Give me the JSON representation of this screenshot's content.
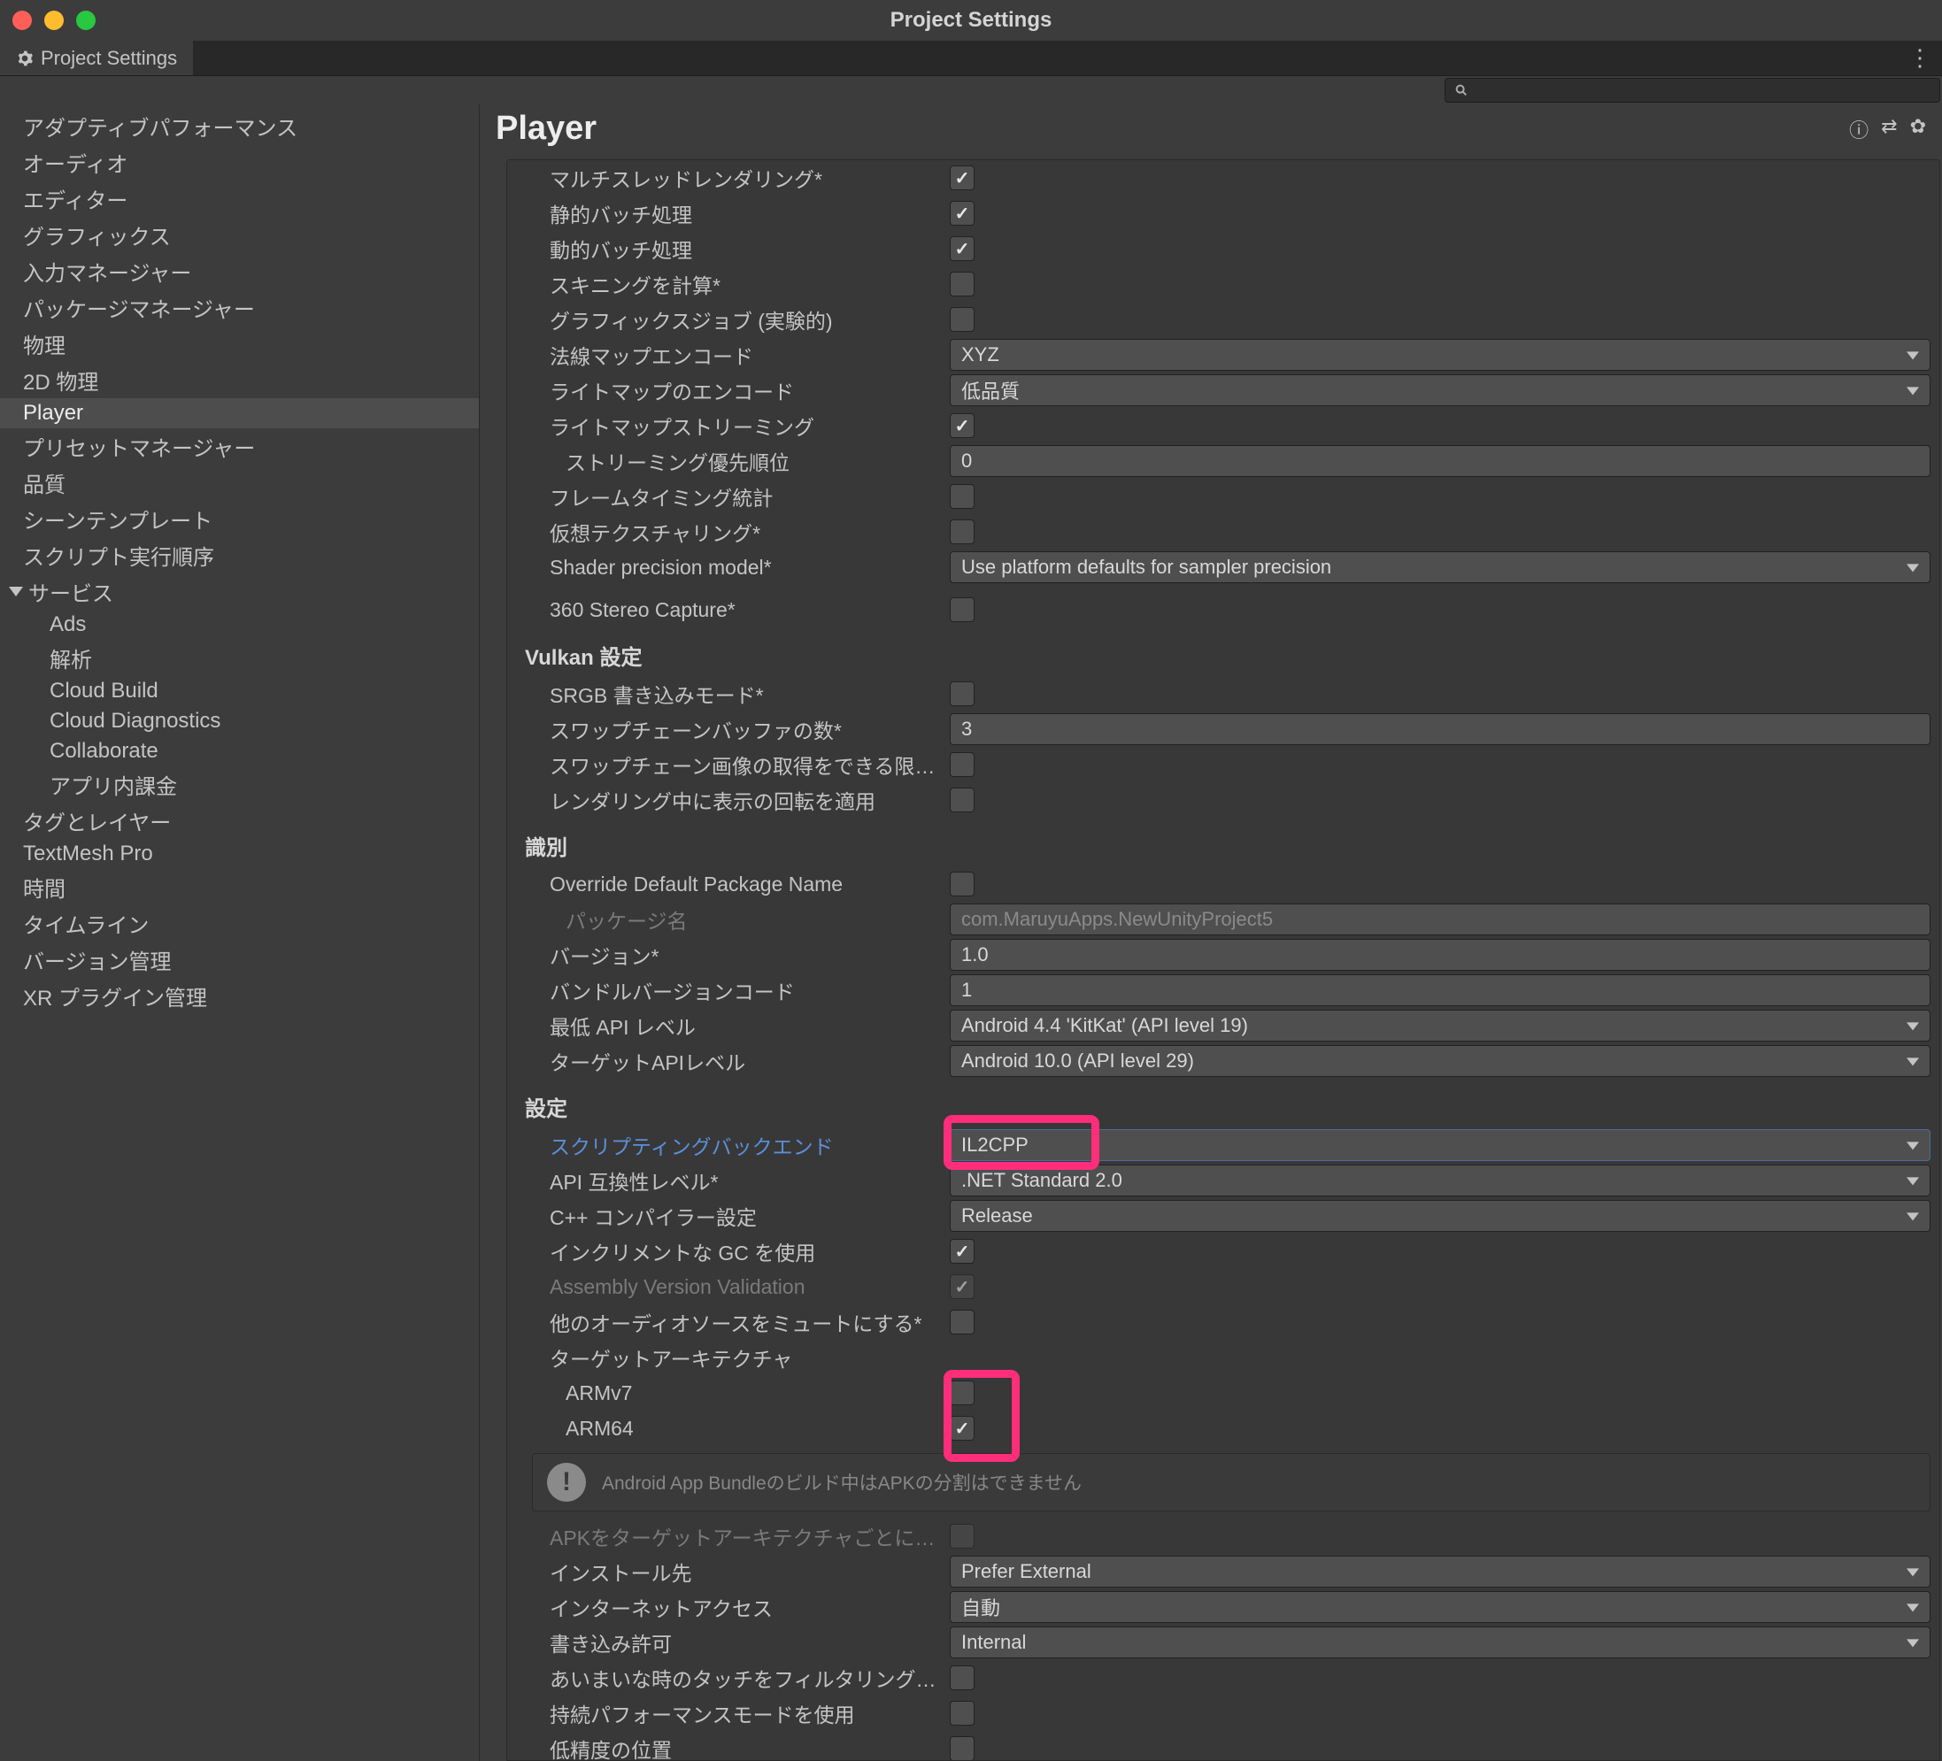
{
  "window": {
    "title": "Project Settings"
  },
  "tab": {
    "label": "Project Settings"
  },
  "sidebar": {
    "items": [
      {
        "label": "アダプティブパフォーマンス"
      },
      {
        "label": "オーディオ"
      },
      {
        "label": "エディター"
      },
      {
        "label": "グラフィックス"
      },
      {
        "label": "入力マネージャー"
      },
      {
        "label": "パッケージマネージャー"
      },
      {
        "label": "物理"
      },
      {
        "label": "2D 物理"
      },
      {
        "label": "Player",
        "selected": true
      },
      {
        "label": "プリセットマネージャー"
      },
      {
        "label": "品質"
      },
      {
        "label": "シーンテンプレート"
      },
      {
        "label": "スクリプト実行順序"
      },
      {
        "label": "サービス",
        "expanded": true,
        "children": [
          {
            "label": "Ads"
          },
          {
            "label": "解析"
          },
          {
            "label": "Cloud Build"
          },
          {
            "label": "Cloud Diagnostics"
          },
          {
            "label": "Collaborate"
          },
          {
            "label": "アプリ内課金"
          }
        ]
      },
      {
        "label": "タグとレイヤー"
      },
      {
        "label": "TextMesh Pro"
      },
      {
        "label": "時間"
      },
      {
        "label": "タイムライン"
      },
      {
        "label": "バージョン管理"
      },
      {
        "label": "XR プラグイン管理"
      }
    ]
  },
  "content": {
    "title": "Player",
    "fields": {
      "multithreadedRendering": {
        "label": "マルチスレッドレンダリング*",
        "checked": true
      },
      "staticBatching": {
        "label": "静的バッチ処理",
        "checked": true
      },
      "dynamicBatching": {
        "label": "動的バッチ処理",
        "checked": true
      },
      "computeSkinning": {
        "label": "スキニングを計算*",
        "checked": false
      },
      "graphicsJobs": {
        "label": "グラフィックスジョブ (実験的)",
        "checked": false
      },
      "normalMapEncoding": {
        "label": "法線マップエンコード",
        "value": "XYZ"
      },
      "lightmapEncoding": {
        "label": "ライトマップのエンコード",
        "value": "低品質"
      },
      "lightmapStreaming": {
        "label": "ライトマップストリーミング",
        "checked": true
      },
      "streamingPriority": {
        "label": "ストリーミング優先順位",
        "value": "0"
      },
      "frameTimingStats": {
        "label": "フレームタイミング統計",
        "checked": false
      },
      "virtualTexturing": {
        "label": "仮想テクスチャリング*",
        "checked": false
      },
      "shaderPrecision": {
        "label": "Shader precision model*",
        "value": "Use platform defaults for sampler precision"
      },
      "stereo360": {
        "label": "360 Stereo Capture*",
        "checked": false
      }
    },
    "vulkan": {
      "title": "Vulkan 設定",
      "srgbWrite": {
        "label": "SRGB 書き込みモード*",
        "checked": false
      },
      "swapchainBuffers": {
        "label": "スワップチェーンバッファの数*",
        "value": "3"
      },
      "swapchainAcquire": {
        "label": "スワップチェーン画像の取得をできる限り遅",
        "checked": false
      },
      "renderingRotation": {
        "label": "レンダリング中に表示の回転を適用",
        "checked": false
      }
    },
    "identification": {
      "title": "識別",
      "overrideDefaultPkg": {
        "label": "Override Default Package Name",
        "checked": false
      },
      "packageName": {
        "label": "パッケージ名",
        "value": "com.MaruyuApps.NewUnityProject5"
      },
      "version": {
        "label": "バージョン*",
        "value": "1.0"
      },
      "bundleVersionCode": {
        "label": "バンドルバージョンコード",
        "value": "1"
      },
      "minApi": {
        "label": "最低 API レベル",
        "value": "Android 4.4 'KitKat' (API level 19)"
      },
      "targetApi": {
        "label": "ターゲットAPIレベル",
        "value": "Android 10.0 (API level 29)"
      }
    },
    "config": {
      "title": "設定",
      "scriptingBackend": {
        "label": "スクリプティングバックエンド",
        "value": "IL2CPP"
      },
      "apiCompat": {
        "label": "API 互換性レベル*",
        "value": ".NET Standard 2.0"
      },
      "cppCompiler": {
        "label": "C++ コンパイラー設定",
        "value": "Release"
      },
      "incrementalGC": {
        "label": "インクリメントな GC を使用",
        "checked": true
      },
      "assemblyValidation": {
        "label": "Assembly Version Validation",
        "checked": true
      },
      "muteOther": {
        "label": "他のオーディオソースをミュートにする*",
        "checked": false
      },
      "targetArch": {
        "label": "ターゲットアーキテクチャ"
      },
      "armv7": {
        "label": "ARMv7",
        "checked": false
      },
      "arm64": {
        "label": "ARM64",
        "checked": true
      },
      "appBundleInfo": "Android App Bundleのビルド中はAPKの分割はできません",
      "splitApks": {
        "label": "APKをターゲットアーキテクチャごとに分割",
        "checked": false
      },
      "installLocation": {
        "label": "インストール先",
        "value": "Prefer External"
      },
      "internetAccess": {
        "label": "インターネットアクセス",
        "value": "自動"
      },
      "writePermission": {
        "label": "書き込み許可",
        "value": "Internal"
      },
      "filterTouches": {
        "label": "あいまいな時のタッチをフィルタリングする",
        "checked": false
      },
      "sustainedPerf": {
        "label": "持続パフォーマンスモードを使用",
        "checked": false
      },
      "lowAccuracyLocation": {
        "label": "低精度の位置",
        "checked": false
      }
    }
  }
}
